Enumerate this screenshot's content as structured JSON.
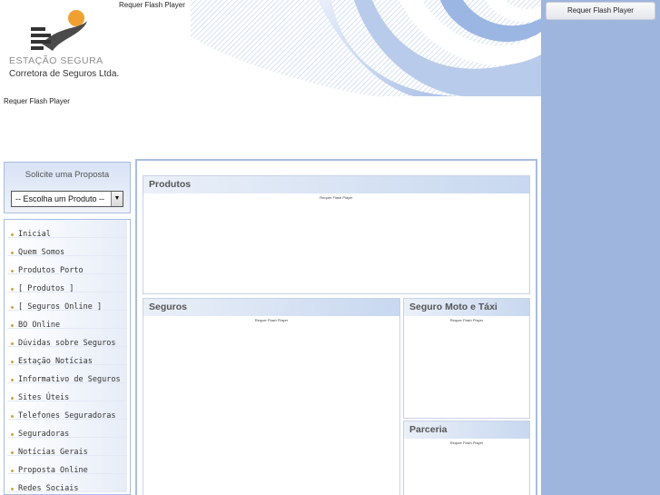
{
  "header": {
    "company_name": "ESTAÇÃO SEGURA",
    "company_sub": "Corretora de Seguros Ltda.",
    "flash_top": "Requer Flash Player",
    "flash_left": "Requer Flash Player"
  },
  "right_panel": {
    "button_label": "Requer Flash Player"
  },
  "proposta": {
    "title": "Solicite uma Proposta",
    "select_value": "-- Escolha um Produto --"
  },
  "menu": {
    "items": [
      "Inicial",
      "Quem Somos",
      "Produtos Porto",
      "[ Produtos ]",
      "[ Seguros Online ]",
      "BO Online",
      "Dúvidas sobre Seguros",
      "Estação Notícias",
      "Informativo de Seguros",
      "Sites Úteis",
      "Telefones Seguradoras",
      "Seguradoras",
      "Notícias Gerais",
      "Proposta Online",
      "Redes Sociais"
    ]
  },
  "panels": {
    "produtos": {
      "title": "Produtos",
      "flash": "Requer Flash Player"
    },
    "seguros": {
      "title": "Seguros",
      "flash": "Requer Flash Player"
    },
    "moto": {
      "title": "Seguro Moto e Táxi",
      "flash": "Requer Flash Player"
    },
    "parceria": {
      "title": "Parceria",
      "flash": "Requer Flash Player"
    }
  },
  "colors": {
    "accent": "#9eb5dd",
    "border": "#a8bde0",
    "logo_sun": "#f0a030"
  }
}
